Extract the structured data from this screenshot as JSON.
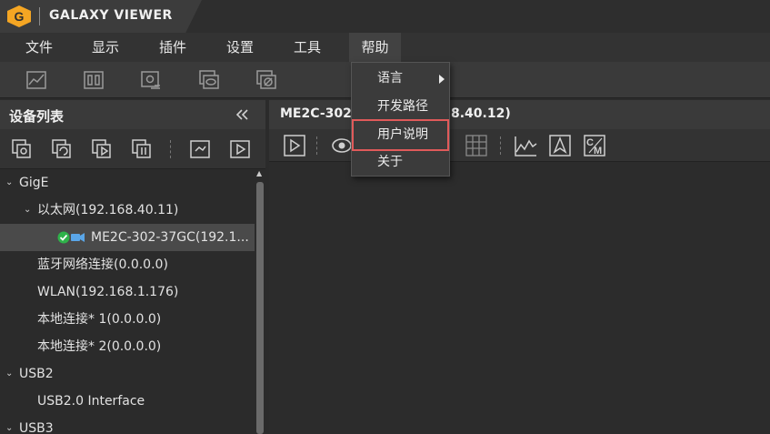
{
  "app": {
    "title": "GALAXY VIEWER",
    "logo_letter": "G",
    "accent": "#f5a623"
  },
  "menubar": {
    "items": [
      {
        "id": "file",
        "label": "文件"
      },
      {
        "id": "display",
        "label": "显示"
      },
      {
        "id": "plugins",
        "label": "插件"
      },
      {
        "id": "settings",
        "label": "设置"
      },
      {
        "id": "tools",
        "label": "工具"
      },
      {
        "id": "help",
        "label": "帮助"
      }
    ]
  },
  "toolbar": {
    "icons": [
      "image-chart-icon",
      "two-panel-icon",
      "capture-settings-icon",
      "view-layers-icon",
      "hide-layers-icon"
    ]
  },
  "device_panel": {
    "title": "设备列表",
    "collapse_icon": "double-chevron-left-icon",
    "tools": [
      "open-device-icon",
      "refresh-device-icon",
      "play-device-icon",
      "stop-device-icon",
      "settings-device-icon",
      "play-icon"
    ],
    "tree": [
      {
        "label": "GigE",
        "level": 0,
        "expanded": true
      },
      {
        "label": "以太网(192.168.40.11)",
        "level": 1,
        "expanded": true
      },
      {
        "label": "ME2C-302-37GC(192.1...",
        "level": 2,
        "selected": true,
        "status": "connected",
        "icon": "camera-connected-icon"
      },
      {
        "label": "蓝牙网络连接(0.0.0.0)",
        "level": 1
      },
      {
        "label": "WLAN(192.168.1.176)",
        "level": 1
      },
      {
        "label": "本地连接* 1(0.0.0.0)",
        "level": 1
      },
      {
        "label": "本地连接* 2(0.0.0.0)",
        "level": 1
      },
      {
        "label": "USB2",
        "level": 0,
        "expanded": true
      },
      {
        "label": "USB2.0 Interface",
        "level": 1
      },
      {
        "label": "USB3",
        "level": 0,
        "expanded": true
      }
    ]
  },
  "view_panel": {
    "title_left": "ME2C-302",
    "title_right": "8.40.12)",
    "tools": [
      "play-icon",
      "eye-icon",
      "grid-icon",
      "histogram-icon",
      "navigate-icon",
      "cm-icon"
    ]
  },
  "help_menu": {
    "items": [
      {
        "label": "语言",
        "has_submenu": true
      },
      {
        "label": "开发路径"
      },
      {
        "label": "用户说明",
        "highlighted": true
      },
      {
        "label": "关于"
      }
    ]
  },
  "colors": {
    "highlight": "#e05a5a",
    "status_ok": "#2fb24a",
    "camera_blue": "#5aa6e8"
  }
}
